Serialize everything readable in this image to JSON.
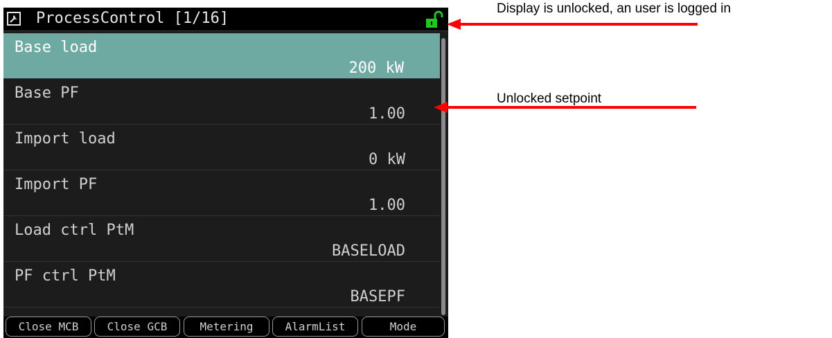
{
  "window": {
    "title": "ProcessControl [1/16]",
    "title_icon": "wrench-icon",
    "lock_icon": "unlocked-padlock-icon"
  },
  "setpoints": [
    {
      "label": "Base load",
      "value": "200 kW",
      "selected": true
    },
    {
      "label": "Base PF",
      "value": "1.00",
      "selected": false
    },
    {
      "label": "Import load",
      "value": "0 kW",
      "selected": false
    },
    {
      "label": "Import PF",
      "value": "1.00",
      "selected": false
    },
    {
      "label": "Load ctrl PtM",
      "value": "BASELOAD",
      "selected": false
    },
    {
      "label": "PF ctrl PtM",
      "value": "BASEPF",
      "selected": false
    }
  ],
  "softkeys": [
    "Close MCB",
    "Close GCB",
    "Metering",
    "AlarmList",
    "Mode"
  ],
  "annotations": {
    "unlocked_display": "Display is unlocked, an user is logged in",
    "unlocked_setpoint": "Unlocked setpoint"
  },
  "colors": {
    "selected_row": "#6eaaa2",
    "lock_icon": "#1ec81e",
    "arrow": "#ff0000"
  }
}
